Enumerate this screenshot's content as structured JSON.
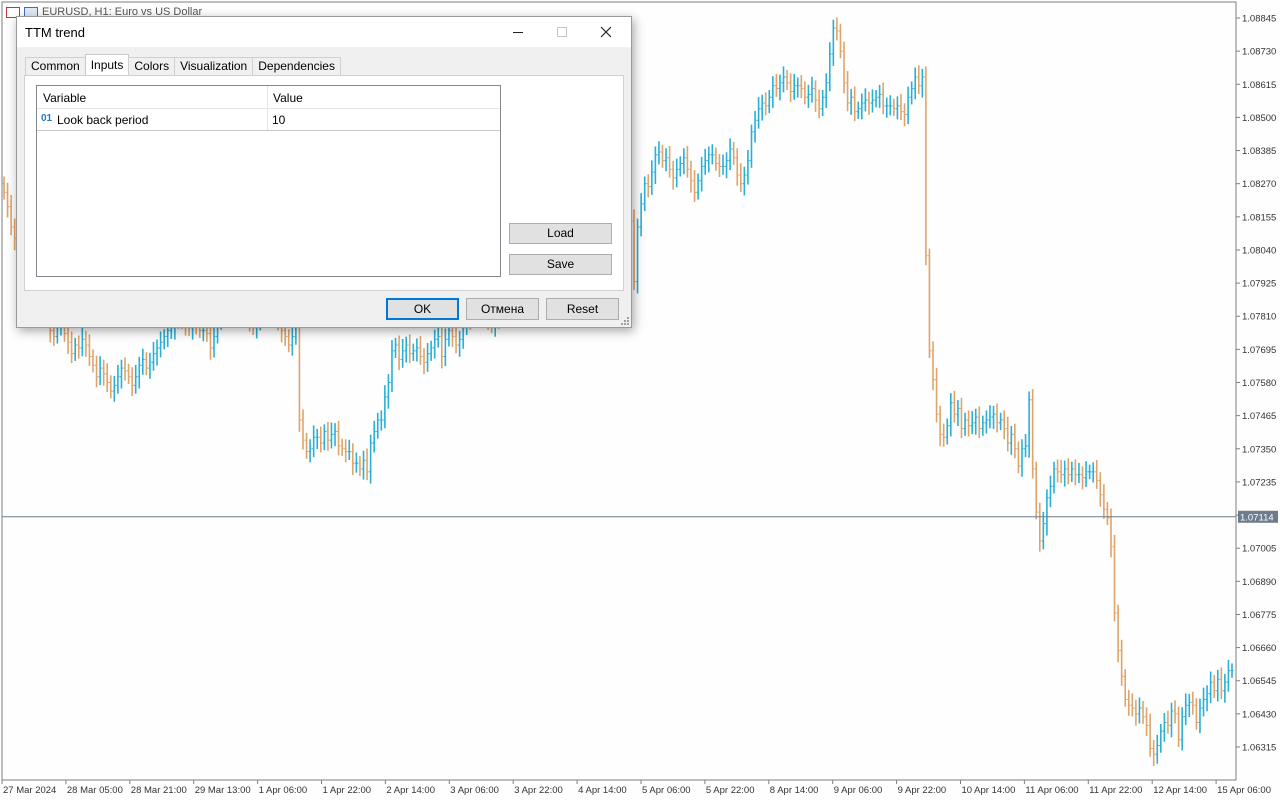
{
  "chart_window": {
    "title": "EURUSD, H1:  Euro vs US Dollar",
    "current_price": "1.07114",
    "colors": {
      "up": "#29afd8",
      "down": "#e0a46a",
      "price_line": "#6c7c8c",
      "label_bg": "#6c7c8c",
      "background": "#fefefe"
    }
  },
  "chart_data": {
    "type": "candlestick",
    "title": "",
    "y_ticks": [
      "1.08845",
      "1.08730",
      "1.08615",
      "1.08500",
      "1.08385",
      "1.08270",
      "1.08155",
      "1.08040",
      "1.07925",
      "1.07810",
      "1.07695",
      "1.07580",
      "1.07465",
      "1.07350",
      "1.07235",
      "1.07120",
      "1.07005",
      "1.06890",
      "1.06775",
      "1.06660",
      "1.06545",
      "1.06430",
      "1.06315"
    ],
    "x_ticks": [
      "27 Mar 2024",
      "28 Mar 05:00",
      "28 Mar 21:00",
      "29 Mar 13:00",
      "1 Apr 06:00",
      "1 Apr 22:00",
      "2 Apr 14:00",
      "3 Apr 06:00",
      "3 Apr 22:00",
      "4 Apr 14:00",
      "5 Apr 06:00",
      "5 Apr 22:00",
      "8 Apr 14:00",
      "9 Apr 06:00",
      "9 Apr 22:00",
      "10 Apr 14:00",
      "11 Apr 06:00",
      "11 Apr 22:00",
      "12 Apr 14:00",
      "15 Apr 06:00"
    ],
    "ylim": [
      1.0625,
      1.089
    ],
    "current_price": 1.07114,
    "closes": [
      1.0824,
      1.0819,
      1.0812,
      1.0808,
      1.0804,
      1.0799,
      1.0795,
      1.0789,
      1.0783,
      1.0785,
      1.0786,
      1.0784,
      1.0781,
      1.0776,
      1.0774,
      1.0778,
      1.078,
      1.0775,
      1.0772,
      1.0768,
      1.0771,
      1.077,
      1.0773,
      1.0771,
      1.0767,
      1.0764,
      1.076,
      1.0763,
      1.0761,
      1.0758,
      1.0755,
      1.0757,
      1.076,
      1.0763,
      1.0762,
      1.076,
      1.0757,
      1.076,
      1.0764,
      1.0766,
      1.0763,
      1.0765,
      1.0768,
      1.077,
      1.0772,
      1.0774,
      1.0776,
      1.0777,
      1.078,
      1.0781,
      1.0779,
      1.0778,
      1.0777,
      1.0779,
      1.0778,
      1.0776,
      1.0776,
      1.0775,
      1.077,
      1.0774,
      1.078,
      1.0782,
      1.0784,
      1.0786,
      1.0786,
      1.0783,
      1.0784,
      1.0782,
      1.0781,
      1.0779,
      1.0777,
      1.0779,
      1.0781,
      1.0784,
      1.0786,
      1.0784,
      1.0785,
      1.0779,
      1.0776,
      1.0774,
      1.0771,
      1.0774,
      1.0779,
      1.0745,
      1.0738,
      1.0734,
      1.0735,
      1.0739,
      1.0739,
      1.0737,
      1.0741,
      1.0738,
      1.074,
      1.0741,
      1.0736,
      1.0735,
      1.0734,
      1.0734,
      1.073,
      1.073,
      1.0728,
      1.0731,
      1.0727,
      1.0737,
      1.0741,
      1.0745,
      1.0745,
      1.0753,
      1.0758,
      1.0769,
      1.0771,
      1.0766,
      1.0769,
      1.0771,
      1.0768,
      1.0769,
      1.077,
      1.0767,
      1.0765,
      1.0768,
      1.077,
      1.0773,
      1.0774,
      1.0767,
      1.0773,
      1.0776,
      1.0774,
      1.0771,
      1.0773,
      1.0777,
      1.0781,
      1.078,
      1.0782,
      1.0784,
      1.0785,
      1.0783,
      1.078,
      1.0778,
      1.078,
      1.0783,
      1.0784,
      1.0785,
      1.0784,
      1.079,
      1.0796,
      1.0802,
      1.0797,
      1.0791,
      1.0799,
      1.0807,
      1.0812,
      1.0818,
      1.0816,
      1.0822,
      1.0825,
      1.0826,
      1.0827,
      1.0828,
      1.0826,
      1.0828,
      1.0833,
      1.0834,
      1.0836,
      1.0838,
      1.0835,
      1.0832,
      1.0829,
      1.0835,
      1.0841,
      1.0838,
      1.0831,
      1.0826,
      1.0831,
      1.0837,
      1.0838,
      1.0827,
      1.0814,
      1.0793,
      1.0812,
      1.082,
      1.0827,
      1.0826,
      1.0831,
      1.0837,
      1.0838,
      1.0835,
      1.0836,
      1.0832,
      1.0829,
      1.0832,
      1.0834,
      1.0836,
      1.0832,
      1.0828,
      1.0824,
      1.0828,
      1.0833,
      1.0835,
      1.0837,
      1.0837,
      1.0834,
      1.0833,
      1.0833,
      1.0835,
      1.0839,
      1.0836,
      1.083,
      1.0827,
      1.083,
      1.0835,
      1.0845,
      1.0849,
      1.0853,
      1.0855,
      1.0854,
      1.0857,
      1.0861,
      1.086,
      1.0862,
      1.0864,
      1.0862,
      1.0859,
      1.0861,
      1.0861,
      1.086,
      1.0857,
      1.0858,
      1.086,
      1.0856,
      1.0853,
      1.0857,
      1.0862,
      1.0872,
      1.0881,
      1.088,
      1.0873,
      1.0862,
      1.0855,
      1.0857,
      1.0852,
      1.0853,
      1.0855,
      1.0856,
      1.0855,
      1.0856,
      1.0857,
      1.0858,
      1.0854,
      1.0854,
      1.0854,
      1.0853,
      1.0854,
      1.0852,
      1.0851,
      1.0857,
      1.086,
      1.0864,
      1.0861,
      1.0864,
      1.0802,
      1.0769,
      1.0759,
      1.0747,
      1.074,
      1.0739,
      1.0743,
      1.0751,
      1.0747,
      1.0749,
      1.0742,
      1.0745,
      1.0743,
      1.0744,
      1.0746,
      1.0742,
      1.0744,
      1.0745,
      1.0746,
      1.0747,
      1.0744,
      1.0745,
      1.0742,
      1.0737,
      1.074,
      1.0735,
      1.0729,
      1.0735,
      1.0736,
      1.0752,
      1.0728,
      1.0713,
      1.0703,
      1.0709,
      1.0718,
      1.0722,
      1.0728,
      1.0727,
      1.0726,
      1.0728,
      1.0726,
      1.0728,
      1.0726,
      1.0726,
      1.0725,
      1.0727,
      1.0727,
      1.0727,
      1.0724,
      1.0719,
      1.0714,
      1.0711,
      1.0701,
      1.0678,
      1.0665,
      1.0656,
      1.0648,
      1.0646,
      1.0645,
      1.0643,
      1.0645,
      1.0642,
      1.0639,
      1.0631,
      1.0629,
      1.0632,
      1.0637,
      1.064,
      1.0639,
      1.0644,
      1.0643,
      1.0634,
      1.0642,
      1.0646,
      1.0647,
      1.0646,
      1.064,
      1.0645,
      1.0648,
      1.065,
      1.0654,
      1.0651,
      1.0655,
      1.0651,
      1.0654,
      1.0658,
      1.0658
    ]
  },
  "dialog": {
    "title": "TTM trend",
    "tabs": [
      {
        "label": "Common"
      },
      {
        "label": "Inputs"
      },
      {
        "label": "Colors"
      },
      {
        "label": "Visualization"
      },
      {
        "label": "Dependencies"
      }
    ],
    "active_tab": "Inputs",
    "table": {
      "col_variable": "Variable",
      "col_value": "Value",
      "rows": [
        {
          "type_icon": "01",
          "variable": "Look back period",
          "value": "10"
        }
      ]
    },
    "buttons": {
      "load": "Load",
      "save": "Save",
      "ok": "OK",
      "cancel": "Отмена",
      "reset": "Reset"
    }
  }
}
